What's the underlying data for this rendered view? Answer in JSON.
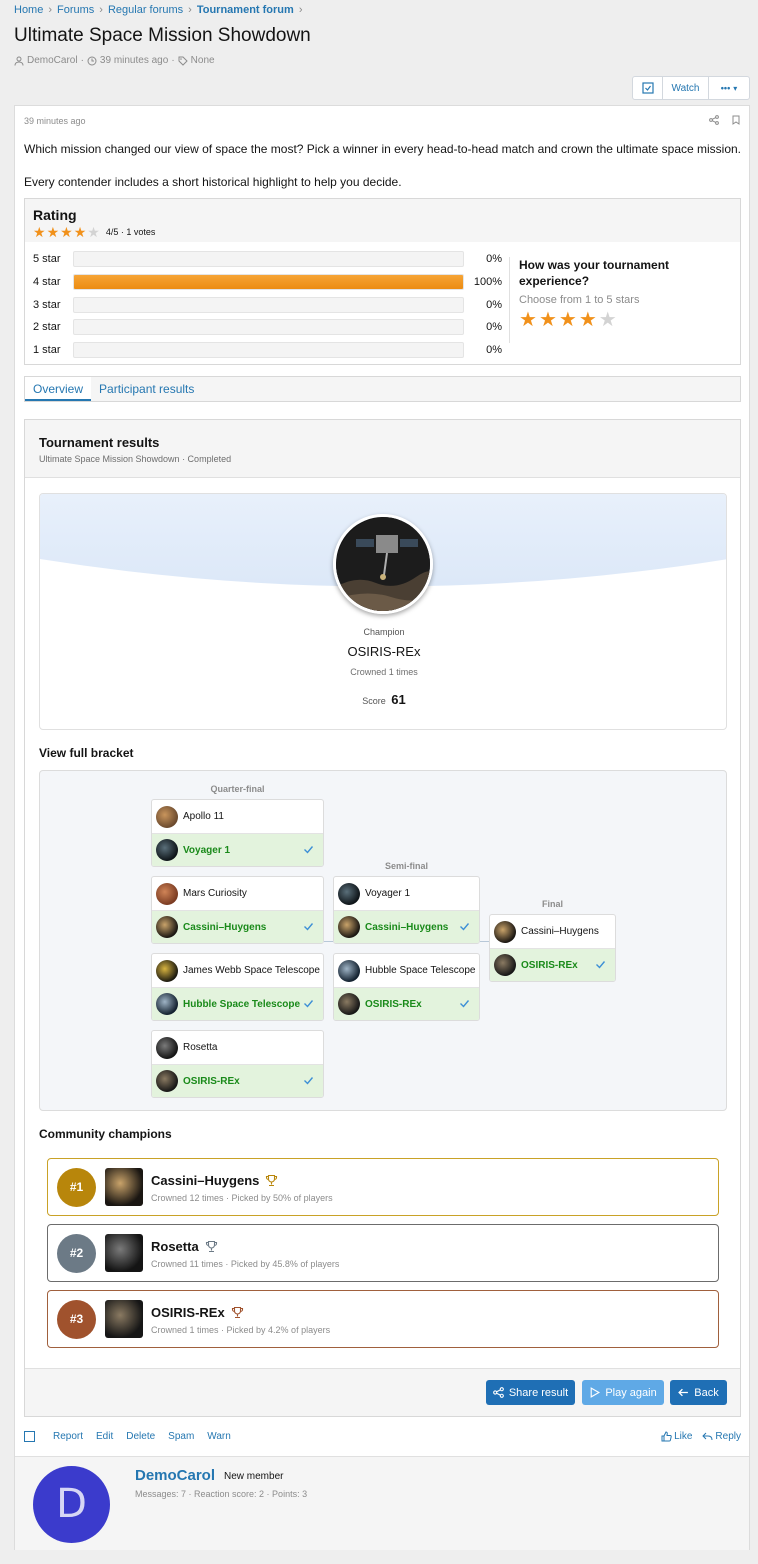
{
  "breadcrumb": [
    "Home",
    "Forums",
    "Regular forums",
    "Tournament forum"
  ],
  "thread": {
    "title": "Ultimate Space Mission Showdown",
    "author": "DemoCarol",
    "time": "39 minutes ago",
    "tags": "None"
  },
  "watchbar": {
    "watch_label": "Watch",
    "more_label": "•••"
  },
  "post": {
    "time": "39 minutes ago",
    "body_1": "Which mission changed our view of space the most? Pick a winner in every head-to-head match and crown the ultimate space mission.",
    "body_2": "Every contender includes a short historical highlight to help you decide."
  },
  "rating": {
    "title": "Rating",
    "score": 4,
    "max": 5,
    "summary": "4/5 · 1 votes",
    "rows": [
      {
        "label": "5 star",
        "pct": 0,
        "pct_text": "0%"
      },
      {
        "label": "4 star",
        "pct": 100,
        "pct_text": "100%"
      },
      {
        "label": "3 star",
        "pct": 0,
        "pct_text": "0%"
      },
      {
        "label": "2 star",
        "pct": 0,
        "pct_text": "0%"
      },
      {
        "label": "1 star",
        "pct": 0,
        "pct_text": "0%"
      }
    ],
    "question": "How was your tournament experience?",
    "hint": "Choose from 1 to 5 stars",
    "user_stars": 4
  },
  "tabs": [
    "Overview",
    "Participant results"
  ],
  "results": {
    "title": "Tournament results",
    "subtitle": "Ultimate Space Mission Showdown · Completed",
    "champion_label": "Champion",
    "champion_name": "OSIRIS-REx",
    "crowned": "Crowned 1 times",
    "score_label": "Score",
    "score": "61",
    "bracket_title": "View full bracket",
    "rounds": [
      "Quarter-final",
      "Semi-final",
      "Final"
    ],
    "quarter": [
      {
        "a": "Apollo 11",
        "b": "Voyager 1"
      },
      {
        "a": "Mars Curiosity",
        "b": "Cassini–Huygens"
      },
      {
        "a": "James Webb Space Telescope",
        "b": "Hubble Space Telescope"
      },
      {
        "a": "Rosetta",
        "b": "OSIRIS-REx"
      }
    ],
    "semi": [
      {
        "a": "Voyager 1",
        "b": "Cassini–Huygens"
      },
      {
        "a": "Hubble Space Telescope",
        "b": "OSIRIS-REx"
      }
    ],
    "final": {
      "a": "Cassini–Huygens",
      "b": "OSIRIS-REx"
    },
    "community_title": "Community champions",
    "community": [
      {
        "rank": "#1",
        "name": "Cassini–Huygens",
        "sub": "Crowned 12 times · Picked by 50% of players",
        "color": "#b8860b",
        "border": "#c9a227"
      },
      {
        "rank": "#2",
        "name": "Rosetta",
        "sub": "Crowned 11 times · Picked by 45.8% of players",
        "color": "#6c7a86",
        "border": "#6c6c6c"
      },
      {
        "rank": "#3",
        "name": "OSIRIS-REx",
        "sub": "Crowned 1 times · Picked by 4.2% of players",
        "color": "#a0522d",
        "border": "#a0603d"
      }
    ],
    "buttons": {
      "share": "Share result",
      "play": "Play again",
      "back": "Back"
    }
  },
  "actions": {
    "report": "Report",
    "edit": "Edit",
    "delete": "Delete",
    "spam": "Spam",
    "warn": "Warn",
    "like": "Like",
    "reply": "Reply"
  },
  "author": {
    "initial": "D",
    "name": "DemoCarol",
    "title": "New member",
    "stats": "Messages: 7 · Reaction score: 2 · Points: 3"
  },
  "colors": {
    "link": "#2577b1",
    "star": "#f1911b",
    "win_bg": "#e3f3dd",
    "win_text": "#1a8a1a",
    "button": "#1f6fb5",
    "avatar": "#3b3bcc"
  }
}
